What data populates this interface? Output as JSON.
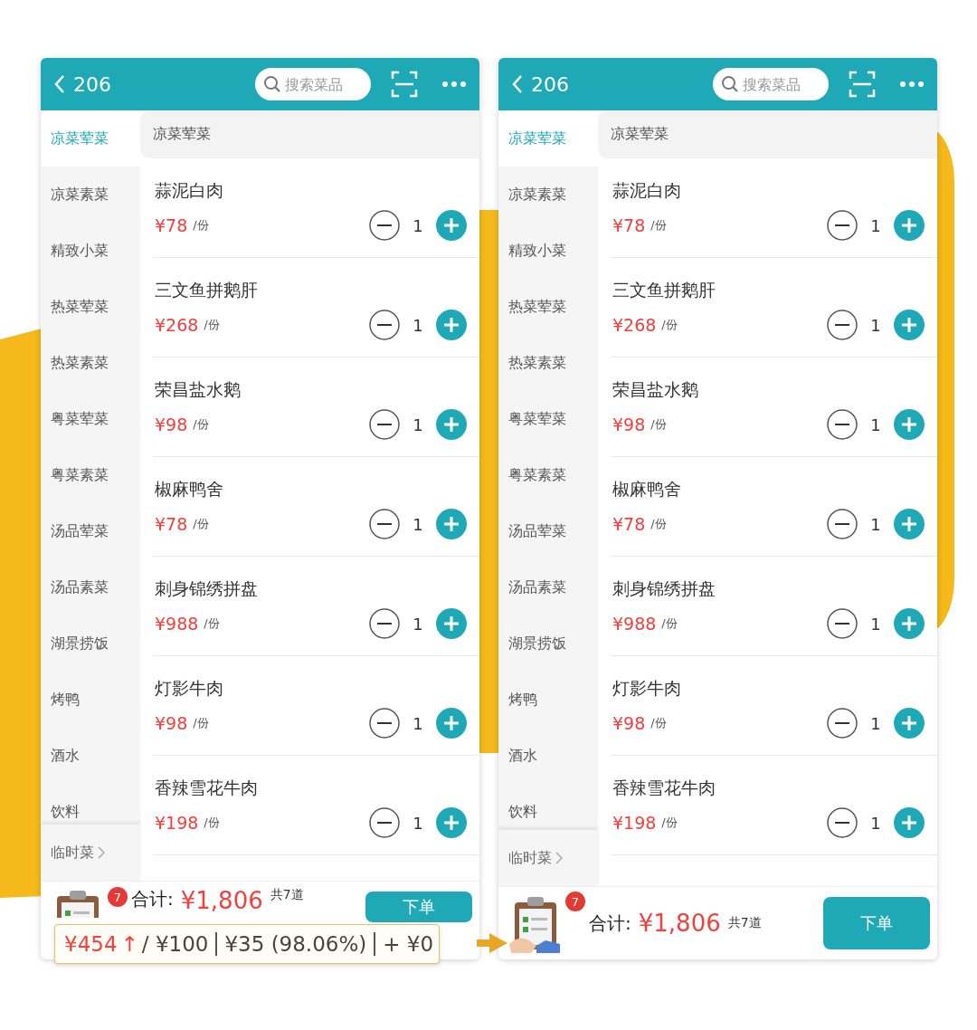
{
  "screens": [
    {
      "header": {
        "back_label": "206",
        "search_placeholder": "搜索菜品"
      },
      "categories": [
        {
          "label": "凉菜荤菜",
          "selected": true
        },
        {
          "label": "凉菜素菜",
          "selected": false
        },
        {
          "label": "精致小菜",
          "selected": false
        },
        {
          "label": "热菜荤菜",
          "selected": false
        },
        {
          "label": "热菜素菜",
          "selected": false
        },
        {
          "label": "粤菜荤菜",
          "selected": false
        },
        {
          "label": "粤菜素菜",
          "selected": false
        },
        {
          "label": "汤品荤菜",
          "selected": false
        },
        {
          "label": "汤品素菜",
          "selected": false
        },
        {
          "label": "湖景捞饭",
          "selected": false
        },
        {
          "label": "烤鸭",
          "selected": false
        },
        {
          "label": "酒水",
          "selected": false
        },
        {
          "label": "饮料",
          "selected": false
        }
      ],
      "temp_category": "临时菜",
      "section_title": "凉菜荤菜",
      "dishes": [
        {
          "name": "蒜泥白肉",
          "price": "¥78",
          "unit": "/份",
          "quantity": "1"
        },
        {
          "name": "三文鱼拼鹅肝",
          "price": "¥268",
          "unit": "/份",
          "quantity": "1"
        },
        {
          "name": "荣昌盐水鹅",
          "price": "¥98",
          "unit": "/份",
          "quantity": "1"
        },
        {
          "name": "椒麻鸭舍",
          "price": "¥78",
          "unit": "/份",
          "quantity": "1"
        },
        {
          "name": "刺身锦绣拼盘",
          "price": "¥988",
          "unit": "/份",
          "quantity": "1"
        },
        {
          "name": "灯影牛肉",
          "price": "¥98",
          "unit": "/份",
          "quantity": "1"
        },
        {
          "name": "香辣雪花牛肉",
          "price": "¥198",
          "unit": "/份",
          "quantity": "1"
        }
      ],
      "cart": {
        "badge": "7",
        "total_label": "合计:",
        "total": "¥1,806",
        "count": "共7道",
        "submit": "下单"
      }
    },
    {
      "header": {
        "back_label": "206",
        "search_placeholder": "搜索菜品"
      },
      "categories": [
        {
          "label": "凉菜荤菜",
          "selected": true
        },
        {
          "label": "凉菜素菜",
          "selected": false
        },
        {
          "label": "精致小菜",
          "selected": false
        },
        {
          "label": "热菜荤菜",
          "selected": false
        },
        {
          "label": "热菜素菜",
          "selected": false
        },
        {
          "label": "粤菜荤菜",
          "selected": false
        },
        {
          "label": "粤菜素菜",
          "selected": false
        },
        {
          "label": "汤品荤菜",
          "selected": false
        },
        {
          "label": "汤品素菜",
          "selected": false
        },
        {
          "label": "湖景捞饭",
          "selected": false
        },
        {
          "label": "烤鸭",
          "selected": false
        },
        {
          "label": "酒水",
          "selected": false
        },
        {
          "label": "饮料",
          "selected": false
        }
      ],
      "temp_category": "临时菜",
      "section_title": "凉菜荤菜",
      "dishes": [
        {
          "name": "蒜泥白肉",
          "price": "¥78",
          "unit": "/份",
          "quantity": "1"
        },
        {
          "name": "三文鱼拼鹅肝",
          "price": "¥268",
          "unit": "/份",
          "quantity": "1"
        },
        {
          "name": "荣昌盐水鹅",
          "price": "¥98",
          "unit": "/份",
          "quantity": "1"
        },
        {
          "name": "椒麻鸭舍",
          "price": "¥78",
          "unit": "/份",
          "quantity": "1"
        },
        {
          "name": "刺身锦绣拼盘",
          "price": "¥988",
          "unit": "/份",
          "quantity": "1"
        },
        {
          "name": "灯影牛肉",
          "price": "¥98",
          "unit": "/份",
          "quantity": "1"
        },
        {
          "name": "香辣雪花牛肉",
          "price": "¥198",
          "unit": "/份",
          "quantity": "1"
        }
      ],
      "cart": {
        "badge": "7",
        "total_label": "合计:",
        "total": "¥1,806",
        "count": "共7道",
        "submit": "下单"
      }
    }
  ],
  "tooltip": {
    "over_amount": "¥454",
    "trend": "↑",
    "budget": "/ ¥100",
    "saving": "¥35 (98.06%)",
    "extra": "+ ¥0"
  }
}
